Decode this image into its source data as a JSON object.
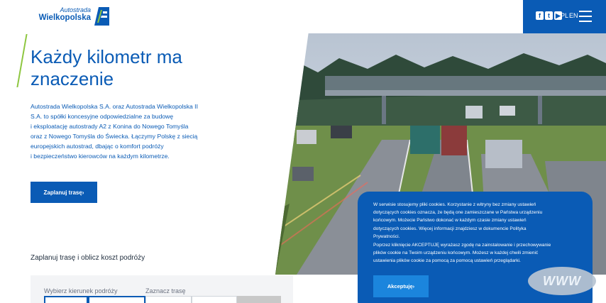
{
  "logo": {
    "line1": "Autostrada",
    "line2": "Wielkopolska"
  },
  "header": {
    "social": [
      {
        "name": "facebook-icon",
        "glyph": "f"
      },
      {
        "name": "twitter-icon",
        "glyph": "t"
      },
      {
        "name": "youtube-icon",
        "glyph": "▶"
      }
    ],
    "lang_pl": "PL",
    "lang_en": "EN"
  },
  "hero": {
    "title": "Każdy kilometr ma znaczenie",
    "description_lines": [
      "Autostrada Wielkopolska S.A. oraz Autostrada Wielkopolska II",
      "S.A. to spółki koncesyjne odpowiedzialne za budowę",
      "i eksploatację autostrady A2 z Konina do Nowego Tomyśla",
      "oraz z Nowego Tomyśla do Świecka. Łączymy Polskę z siecią",
      "europejskich autostrad, dbając o komfort podróży",
      "i bezpieczeństwo kierowców na każdym kilometrze."
    ],
    "plan_button": "Zaplanuj trasę›"
  },
  "planner": {
    "section_title": "Zaplanuj trasę i oblicz koszt podróży",
    "direction_label": "Wybierz kierunek podróży",
    "route_label": "Zaznacz trasę"
  },
  "cookie": {
    "paragraph1_lines": [
      "W serwisie stosujemy pliki cookies. Korzystanie z witryny bez zmiany ustawień",
      "dotyczących cookies oznacza, że będą one zamieszczane w Państwa urządzeniu",
      "końcowym. Możecie Państwo dokonać w każdym czasie zmiany ustawień",
      "dotyczących cookies. Więcej informacji znajdziesz w dokumencie Polityka",
      "Prywatności."
    ],
    "paragraph2_lines": [
      "Poprzez kliknięcie AKCEPTUJĘ wyrażasz zgodę na zainstalowanie i przechowywanie",
      "plików cookie na Twoim urządzeniu końcowym. Możesz w każdej chwili zmienić",
      "ustawienia plików cookie za pomocą za pomocą ustawień przeglądarki."
    ],
    "accept_button": "Akceptuję›"
  },
  "badge": {
    "text": "WWW"
  },
  "colors": {
    "brand_blue": "#0a5bb5",
    "accent_green": "#8dc63f",
    "cookie_button": "#1b85dd"
  }
}
